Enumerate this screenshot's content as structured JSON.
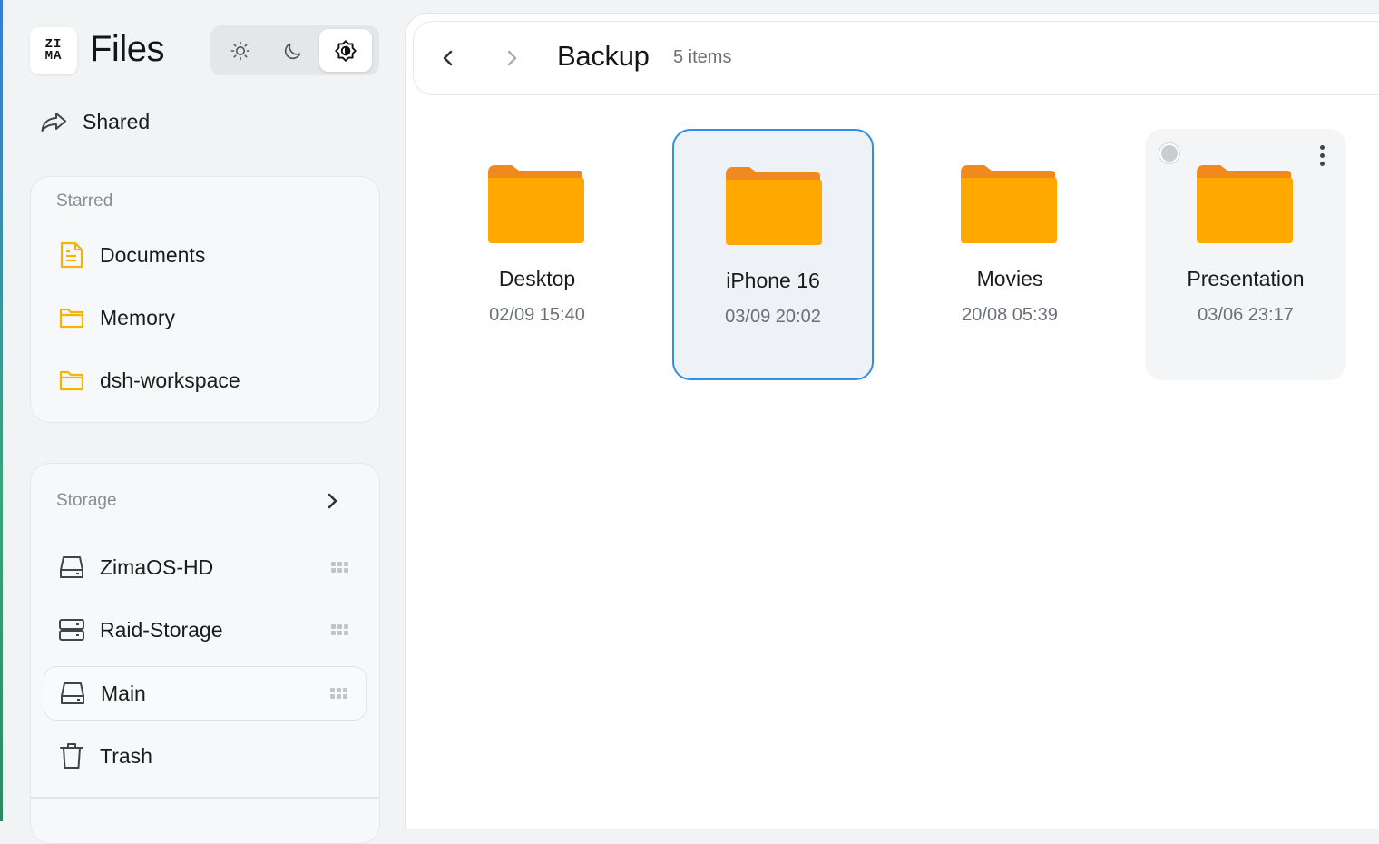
{
  "app": {
    "logo_line1": "ZI",
    "logo_line2": "MA",
    "title": "Files"
  },
  "theme": {
    "options": [
      "light",
      "dark",
      "auto"
    ],
    "selected": "auto"
  },
  "sidebar": {
    "shared_label": "Shared",
    "starred": {
      "heading": "Starred",
      "items": [
        {
          "label": "Documents",
          "icon": "document-icon"
        },
        {
          "label": "Memory",
          "icon": "folder-outline-icon"
        },
        {
          "label": "dsh-workspace",
          "icon": "folder-outline-icon"
        }
      ]
    },
    "storage": {
      "heading": "Storage",
      "items": [
        {
          "label": "ZimaOS-HD",
          "icon": "drive-icon"
        },
        {
          "label": "Raid-Storage",
          "icon": "raid-icon"
        },
        {
          "label": "Main",
          "icon": "drive-icon",
          "selected": true
        },
        {
          "label": "Trash",
          "icon": "trash-icon"
        }
      ]
    }
  },
  "toolbar": {
    "breadcrumb": "Backup",
    "item_count": "5 items"
  },
  "files": [
    {
      "name": "Desktop",
      "date": "02/09 15:40",
      "state": "normal"
    },
    {
      "name": "iPhone 16",
      "date": "03/09 20:02",
      "state": "selected"
    },
    {
      "name": "Movies",
      "date": "20/08 05:39",
      "state": "normal"
    },
    {
      "name": "Presentation",
      "date": "03/06 23:17",
      "state": "hover"
    }
  ],
  "colors": {
    "folder": "#ffa800",
    "folder_tab": "#f08a1c",
    "accent": "#2f8fe6",
    "starred_icon": "#f5b400"
  }
}
